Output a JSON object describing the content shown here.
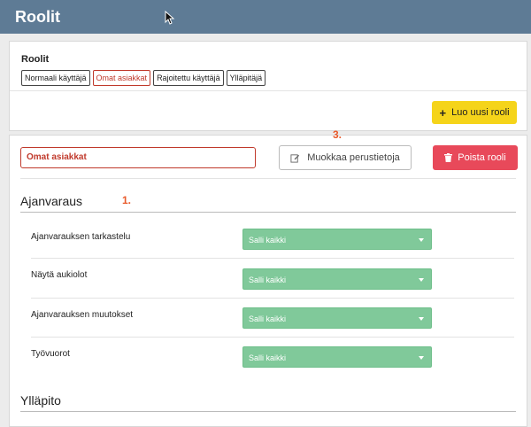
{
  "header": {
    "title": "Roolit"
  },
  "roles_card": {
    "label": "Roolit",
    "tags": [
      {
        "label": "Normaali käyttäjä",
        "active": false
      },
      {
        "label": "Omat asiakkat",
        "active": true
      },
      {
        "label": "Rajoitettu käyttäjä",
        "active": false
      },
      {
        "label": "Ylläpitäjä",
        "active": false
      }
    ],
    "create_button": "Luo uusi rooli"
  },
  "detail": {
    "role_name": "Omat asiakkat",
    "edit_button": "Muokkaa perustietoja",
    "delete_button": "Poista rooli",
    "annotations": {
      "section": "1.",
      "edit": "3."
    },
    "sections": [
      {
        "title": "Ajanvaraus",
        "rows": [
          {
            "label": "Ajanvarauksen tarkastelu",
            "value": "Salli kaikki"
          },
          {
            "label": "Näytä aukiolot",
            "value": "Salli kaikki"
          },
          {
            "label": "Ajanvarauksen muutokset",
            "value": "Salli kaikki"
          },
          {
            "label": "Työvuorot",
            "value": "Salli kaikki"
          }
        ]
      },
      {
        "title": "Ylläpito",
        "rows": []
      }
    ]
  },
  "colors": {
    "topbar": "#5e7b95",
    "accent_red": "#e8495a",
    "create_yellow": "#f5d41a",
    "select_green": "#80c99a",
    "annotation": "#e85a2b"
  }
}
